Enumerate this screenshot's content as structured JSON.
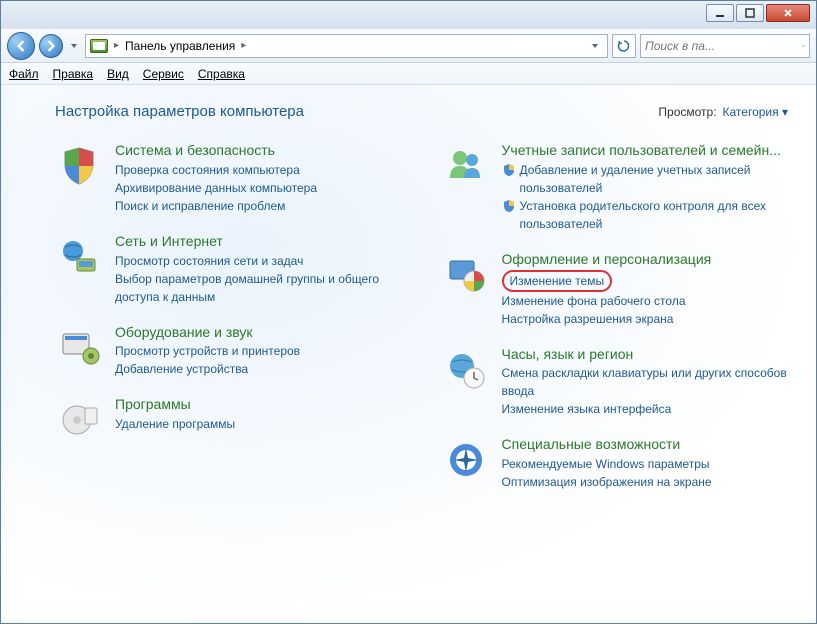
{
  "address": {
    "location": "Панель управления"
  },
  "search": {
    "placeholder": "Поиск в па..."
  },
  "menu": {
    "file": "Файл",
    "edit": "Правка",
    "view": "Вид",
    "tools": "Сервис",
    "help": "Справка"
  },
  "page": {
    "title": "Настройка параметров компьютера",
    "view_label": "Просмотр:",
    "view_value": "Категория"
  },
  "left": [
    {
      "title": "Система и безопасность",
      "links": [
        "Проверка состояния компьютера",
        "Архивирование данных компьютера",
        "Поиск и исправление проблем"
      ]
    },
    {
      "title": "Сеть и Интернет",
      "links": [
        "Просмотр состояния сети и задач",
        "Выбор параметров домашней группы и общего доступа к данным"
      ]
    },
    {
      "title": "Оборудование и звук",
      "links": [
        "Просмотр устройств и принтеров",
        "Добавление устройства"
      ]
    },
    {
      "title": "Программы",
      "links": [
        "Удаление программы"
      ]
    }
  ],
  "right": [
    {
      "title": "Учетные записи пользователей и семейн...",
      "shielded": [
        "Добавление и удаление учетных записей пользователей",
        "Установка родительского контроля для всех пользователей"
      ]
    },
    {
      "title": "Оформление и персонализация",
      "links": [
        "Изменение темы",
        "Изменение фона рабочего стола",
        "Настройка разрешения экрана"
      ],
      "highlight_index": 0
    },
    {
      "title": "Часы, язык и регион",
      "links": [
        "Смена раскладки клавиатуры или других способов ввода",
        "Изменение языка интерфейса"
      ]
    },
    {
      "title": "Специальные возможности",
      "links": [
        "Рекомендуемые Windows параметры",
        "Оптимизация изображения на экране"
      ]
    }
  ]
}
